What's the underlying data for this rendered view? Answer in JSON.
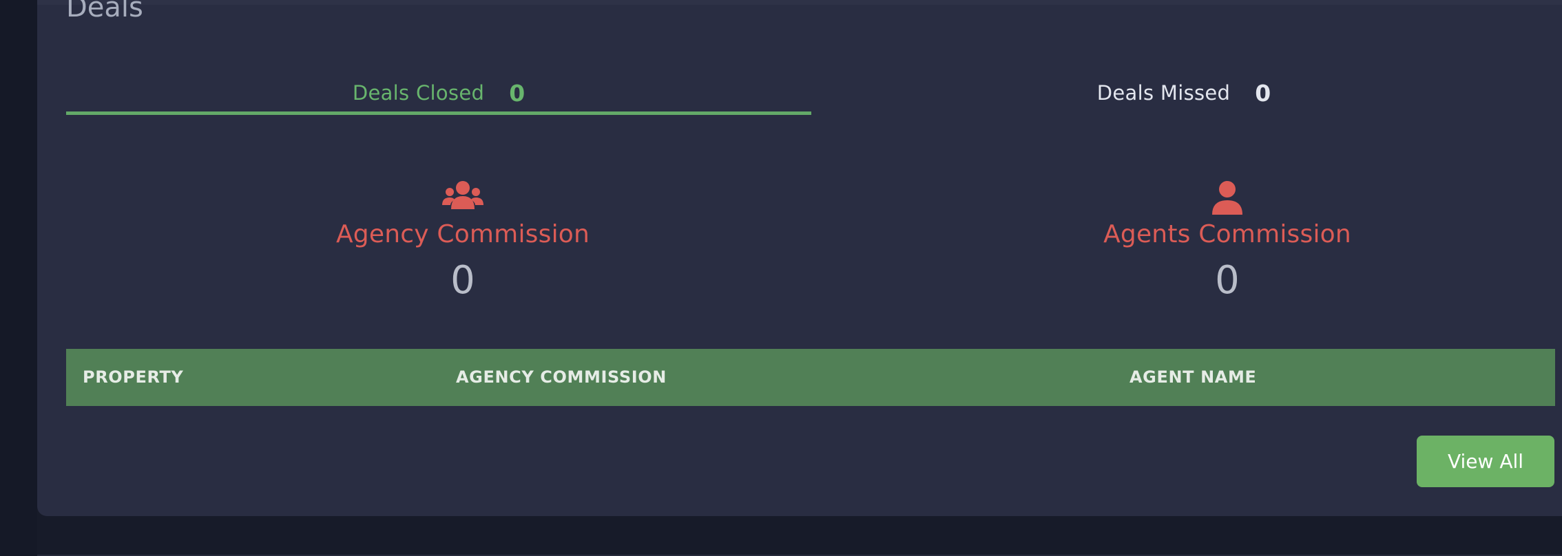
{
  "section": {
    "title": "Deals"
  },
  "tabs": {
    "closed": {
      "label": "Deals Closed",
      "count": "0"
    },
    "missed": {
      "label": "Deals Missed",
      "count": "0"
    }
  },
  "stats": {
    "agency": {
      "label": "Agency Commission",
      "value": "0",
      "icon": "users-group-icon"
    },
    "agents": {
      "label": "Agents Commission",
      "value": "0",
      "icon": "user-icon"
    }
  },
  "table": {
    "columns": [
      "PROPERTY",
      "AGENCY COMMISSION",
      "AGENT NAME"
    ]
  },
  "actions": {
    "view_all_label": "View All"
  },
  "colors": {
    "accent_green": "#68b56d",
    "header_green": "#518056",
    "commission_red": "#dc5c56",
    "card_bg": "#292d42",
    "page_bg": "#171b29"
  }
}
